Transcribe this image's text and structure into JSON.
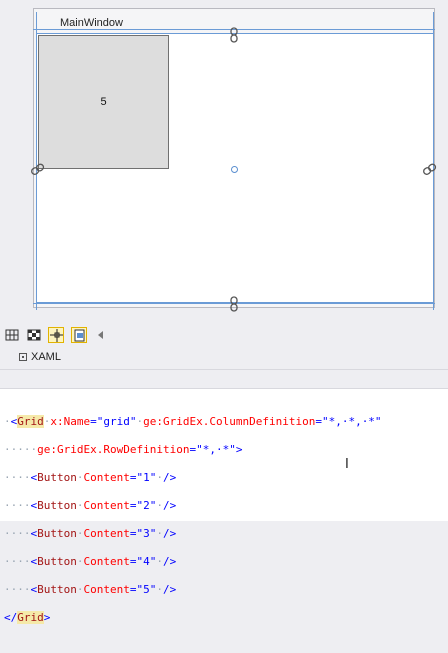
{
  "designer": {
    "window_title": "MainWindow",
    "button_label": "5"
  },
  "toolbar": {
    "icons": [
      "grid-toggle-icon",
      "checker-icon",
      "snap-grid-icon",
      "snap-lines-icon",
      "collapse-arrow-icon"
    ]
  },
  "tabs": [
    {
      "label": "XAML"
    }
  ],
  "xaml": {
    "line1": {
      "lead": "·",
      "open": "<",
      "element": "Grid",
      "s1": "·",
      "attr1": "x:Name",
      "eq1": "=",
      "val1": "\"grid\"",
      "s2": "·",
      "attr2_prefix": "ge:",
      "attr2": "GridEx.ColumnDefinition",
      "eq2": "=",
      "val2": "\"*,·*,·*\""
    },
    "line2": {
      "lead": "·····",
      "attr_prefix": "ge:",
      "attr": "GridEx.RowDefinition",
      "eq": "=",
      "val": "\"*,·*\"",
      "close": ">"
    },
    "buttons": [
      {
        "lead": "····",
        "open": "<",
        "element": "Button",
        "s": "·",
        "attr": "Content",
        "eq": "=",
        "val": "\"1\"",
        "s2": "·",
        "close": "/>"
      },
      {
        "lead": "····",
        "open": "<",
        "element": "Button",
        "s": "·",
        "attr": "Content",
        "eq": "=",
        "val": "\"2\"",
        "s2": "·",
        "close": "/>"
      },
      {
        "lead": "····",
        "open": "<",
        "element": "Button",
        "s": "·",
        "attr": "Content",
        "eq": "=",
        "val": "\"3\"",
        "s2": "·",
        "close": "/>"
      },
      {
        "lead": "····",
        "open": "<",
        "element": "Button",
        "s": "·",
        "attr": "Content",
        "eq": "=",
        "val": "\"4\"",
        "s2": "·",
        "close": "/>"
      },
      {
        "lead": "····",
        "open": "<",
        "element": "Button",
        "s": "·",
        "attr": "Content",
        "eq": "=",
        "val": "\"5\"",
        "s2": "·",
        "close": "/>"
      }
    ],
    "closing": {
      "open": "</",
      "element": "Grid",
      "close": ">"
    }
  }
}
